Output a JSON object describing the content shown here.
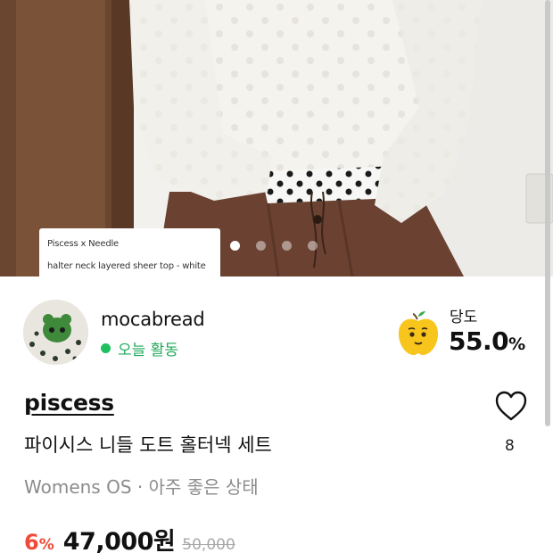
{
  "photo": {
    "caption_line1": "Piscess x Needle",
    "caption_line2": "halter neck layered sheer top - white",
    "slide_count": 4,
    "active_slide": 1
  },
  "seller": {
    "name": "mocabread",
    "status": "오늘 활동",
    "status_color": "#1ec05f"
  },
  "sweetness": {
    "label": "당도",
    "value": "55.0",
    "unit": "%"
  },
  "product": {
    "brand": "piscess",
    "title": "파이시스 니들 도트 홀터넥 세트",
    "meta": "Womens OS · 아주 좋은 상태",
    "like_count": "8"
  },
  "price": {
    "discount": "6",
    "discount_unit": "%",
    "price": "47,000원",
    "original_price": "50,000",
    "discount_color": "#f04a38"
  },
  "icons": {
    "like": "heart-icon",
    "sweetness": "apple-icon"
  }
}
